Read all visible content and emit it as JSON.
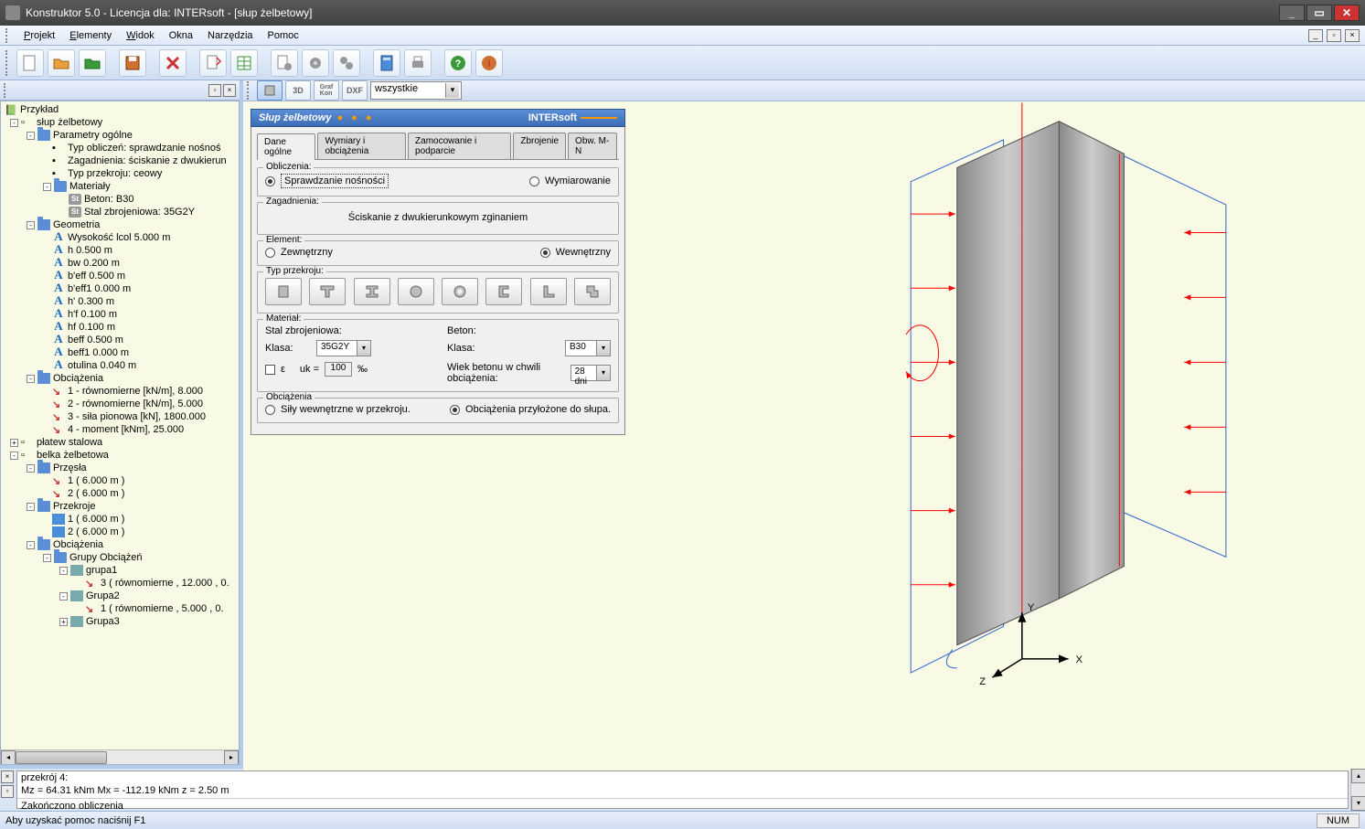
{
  "title": "Konstruktor 5.0 - Licencja dla: INTERsoft - [słup żelbetowy]",
  "menu": {
    "projekt": "Projekt",
    "elementy": "Elementy",
    "widok": "Widok",
    "okna": "Okna",
    "narzedzia": "Narzędzia",
    "pomoc": "Pomoc"
  },
  "viewbar": {
    "combo": "wszystkie",
    "b3d": "3D",
    "graf": "Graf",
    "dxf": "DXF"
  },
  "tree": {
    "root": "Przykład",
    "n0": "słup żelbetowy",
    "n1": "Parametry ogólne",
    "n1a": "Typ obliczeń: sprawdzanie nośnoś",
    "n1b": "Zagadnienia: ściskanie z dwukierun",
    "n1c": "Typ przekroju: ceowy",
    "n1d": "Materiały",
    "n1d1": "Beton: B30",
    "n1d2": "Stal zbrojeniowa: 35G2Y",
    "n2": "Geometria",
    "n2a": "Wysokość lcol 5.000 m",
    "n2b": "h 0.500 m",
    "n2c": "bw 0.200 m",
    "n2d": "b'eff 0.500 m",
    "n2e": "b'eff1 0.000 m",
    "n2f": "h' 0.300 m",
    "n2g": "h'f 0.100 m",
    "n2h": "hf 0.100 m",
    "n2i": "beff 0.500 m",
    "n2j": "beff1 0.000 m",
    "n2k": "otulina 0.040 m",
    "n3": "Obciążenia",
    "n3a": "1 - równomierne [kN/m], 8.000",
    "n3b": "2 - równomierne [kN/m], 5.000",
    "n3c": "3 - siła pionowa [kN], 1800.000",
    "n3d": "4 - moment [kNm], 25.000",
    "n4": "płatew stalowa",
    "n5": "belka żelbetowa",
    "n5a": "Przęsła",
    "n5a1": "1 ( 6.000 m )",
    "n5a2": "2 ( 6.000 m )",
    "n5b": "Przekroje",
    "n5b1": "1 ( 6.000 m )",
    "n5b2": "2 ( 6.000 m )",
    "n5c": "Obciążenia",
    "n5c1": "Grupy Obciążeń",
    "n5c1a": "grupa1",
    "n5c1a1": "3 ( równomierne , 12.000 , 0.",
    "n5c1b": "Grupa2",
    "n5c1b1": "1 ( równomierne , 5.000 , 0.",
    "n5c1c": "Grupa3"
  },
  "form": {
    "title": "Słup żelbetowy",
    "brand": "INTERsoft",
    "tabs": {
      "t1": "Dane ogólne",
      "t2": "Wymiary i obciążenia",
      "t3": "Zamocowanie i podparcie",
      "t4": "Zbrojenie",
      "t5": "Obw. M-N"
    },
    "obliczenia": {
      "leg": "Obliczenia:",
      "r1": "Sprawdzanie nośności",
      "r2": "Wymiarowanie"
    },
    "zagadnienia": {
      "leg": "Zagadnienia:",
      "txt": "Ściskanie z dwukierunkowym zginaniem"
    },
    "element": {
      "leg": "Element:",
      "r1": "Zewnętrzny",
      "r2": "Wewnętrzny"
    },
    "typ": {
      "leg": "Typ przekroju:"
    },
    "material": {
      "leg": "Materiał:",
      "stal": "Stal zbrojeniowa:",
      "klasa": "Klasa:",
      "stalv": "35G2Y",
      "beton": "Beton:",
      "betonv": "B30",
      "eps": "ε",
      "uk": "uk =",
      "ukv": "100",
      "perm": "‰",
      "wiek": "Wiek betonu w chwili obciążenia:",
      "wiekv": "28 dni"
    },
    "obc": {
      "leg": "Obciążenia",
      "r1": "Siły wewnętrzne w przekroju.",
      "r2": "Obciążenia przyłożone do słupa."
    }
  },
  "axes": {
    "x": "X",
    "y": "Y",
    "z": "Z"
  },
  "log": {
    "l1": "przekrój 4:",
    "l2": "Mz = 64.31 kNm   Mx = -112.19 kNm  z = 2.50 m",
    "l3": "Zakończono obliczenia"
  },
  "status": {
    "help": "Aby uzyskać pomoc naciśnij F1",
    "num": "NUM"
  }
}
